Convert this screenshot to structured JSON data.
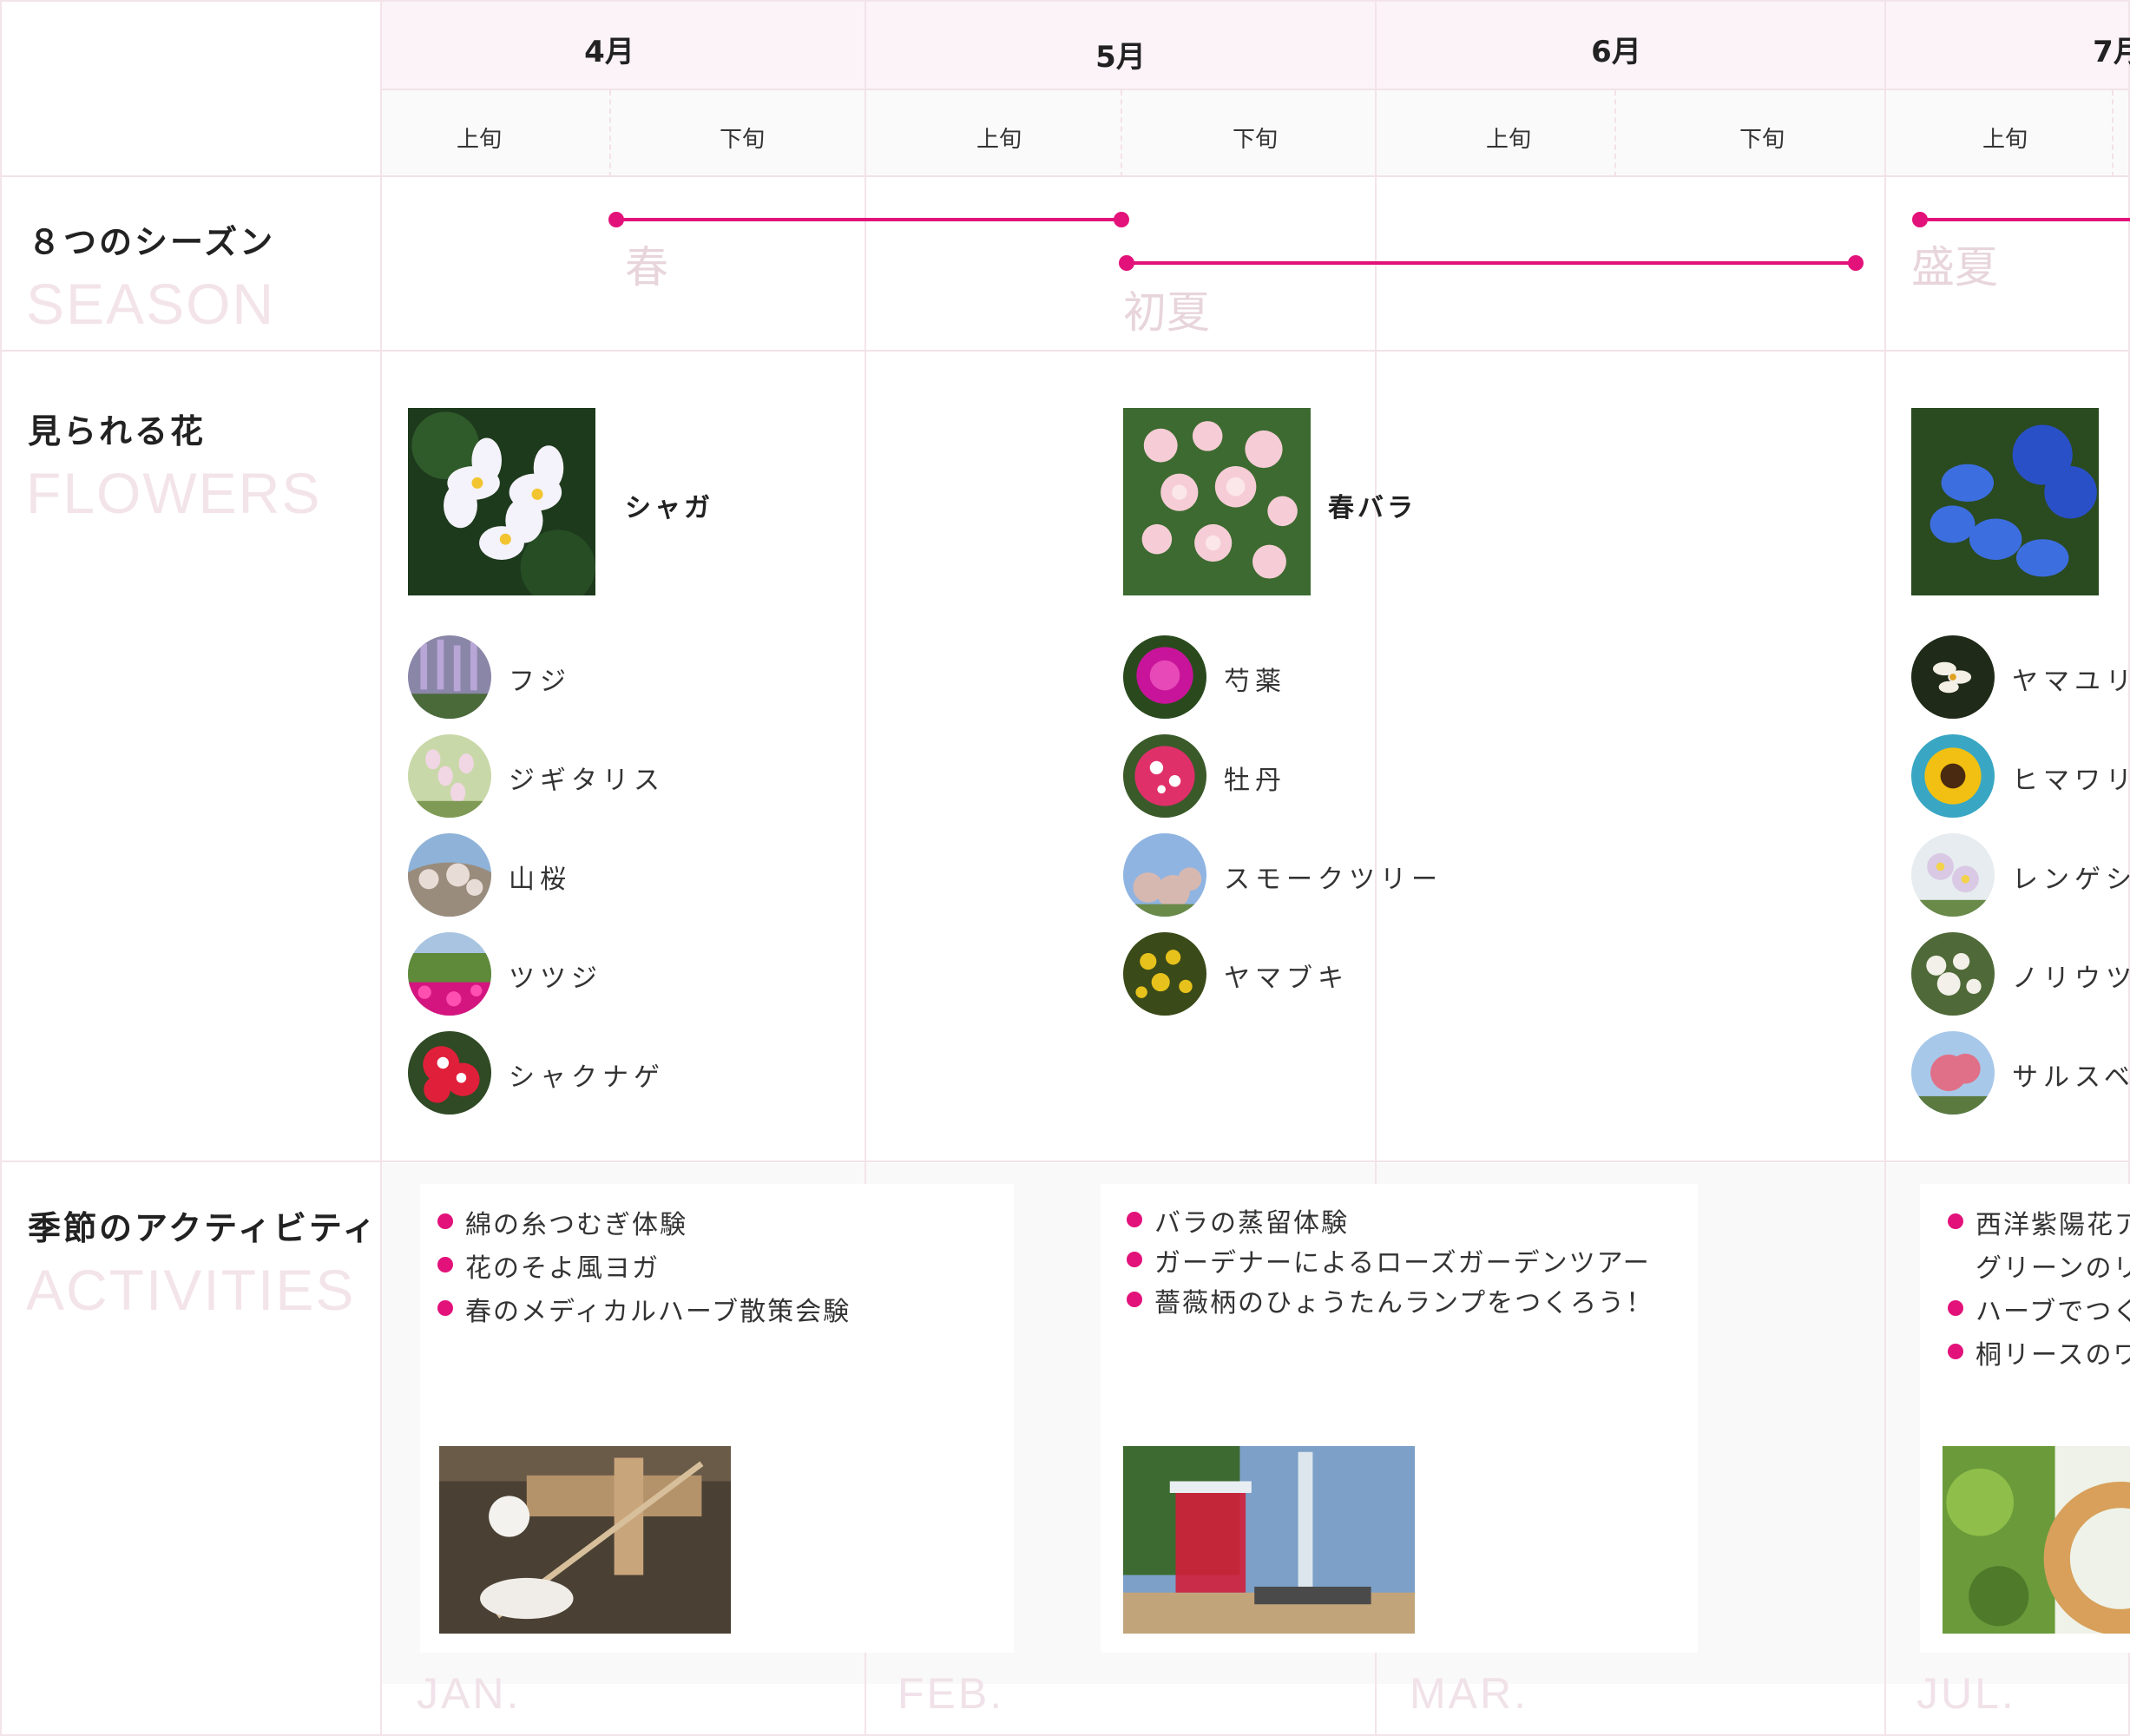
{
  "header": {
    "months": [
      "4月",
      "5月",
      "6月",
      "7月"
    ],
    "halves": [
      "上旬",
      "下旬",
      "上旬",
      "下旬",
      "上旬",
      "下旬",
      "上旬"
    ]
  },
  "rows": {
    "season": {
      "title": "８つのシーズン",
      "sub": "SEASON"
    },
    "flowers": {
      "title": "見られる花",
      "sub": "FLOWERS"
    },
    "activities": {
      "title": "季節のアクティビティ",
      "sub": "ACTIVITIES"
    }
  },
  "seasons": [
    "春",
    "初夏",
    "盛夏"
  ],
  "flower_columns": [
    {
      "feature": "シャガ",
      "items": [
        "フジ",
        "ジギタリス",
        "山桜",
        "ツツジ",
        "シャクナゲ"
      ]
    },
    {
      "feature": "春バラ",
      "items": [
        "芍薬",
        "牡丹",
        "スモークツリー",
        "ヤマブキ"
      ]
    },
    {
      "feature": "",
      "items": [
        "ヤマユリ",
        "ヒマワリ",
        "レンゲシ",
        "ノリウツ",
        "サルスベ"
      ]
    }
  ],
  "activity_cards": [
    {
      "items": [
        "綿の糸つむぎ体験",
        "花のそよ風ヨガ",
        "春のメディカルハーブ散策会験"
      ]
    },
    {
      "items": [
        "バラの蒸留体験",
        "ガーデナーによるローズガーデンツアー",
        "薔薇柄のひょうたんランプをつくろう！"
      ]
    },
    {
      "items": [
        "西洋紫陽花ア",
        "グリーンのリ",
        "ハーブでつく",
        "桐リースのワ"
      ]
    }
  ],
  "month_en": [
    "JAN.",
    "FEB.",
    "MAR.",
    "JUL."
  ],
  "colors": {
    "accent": "#e2127a",
    "grid": "#f3e4ea",
    "month_band": "#fcf3f8",
    "faint_text": "#f3e4ea"
  }
}
